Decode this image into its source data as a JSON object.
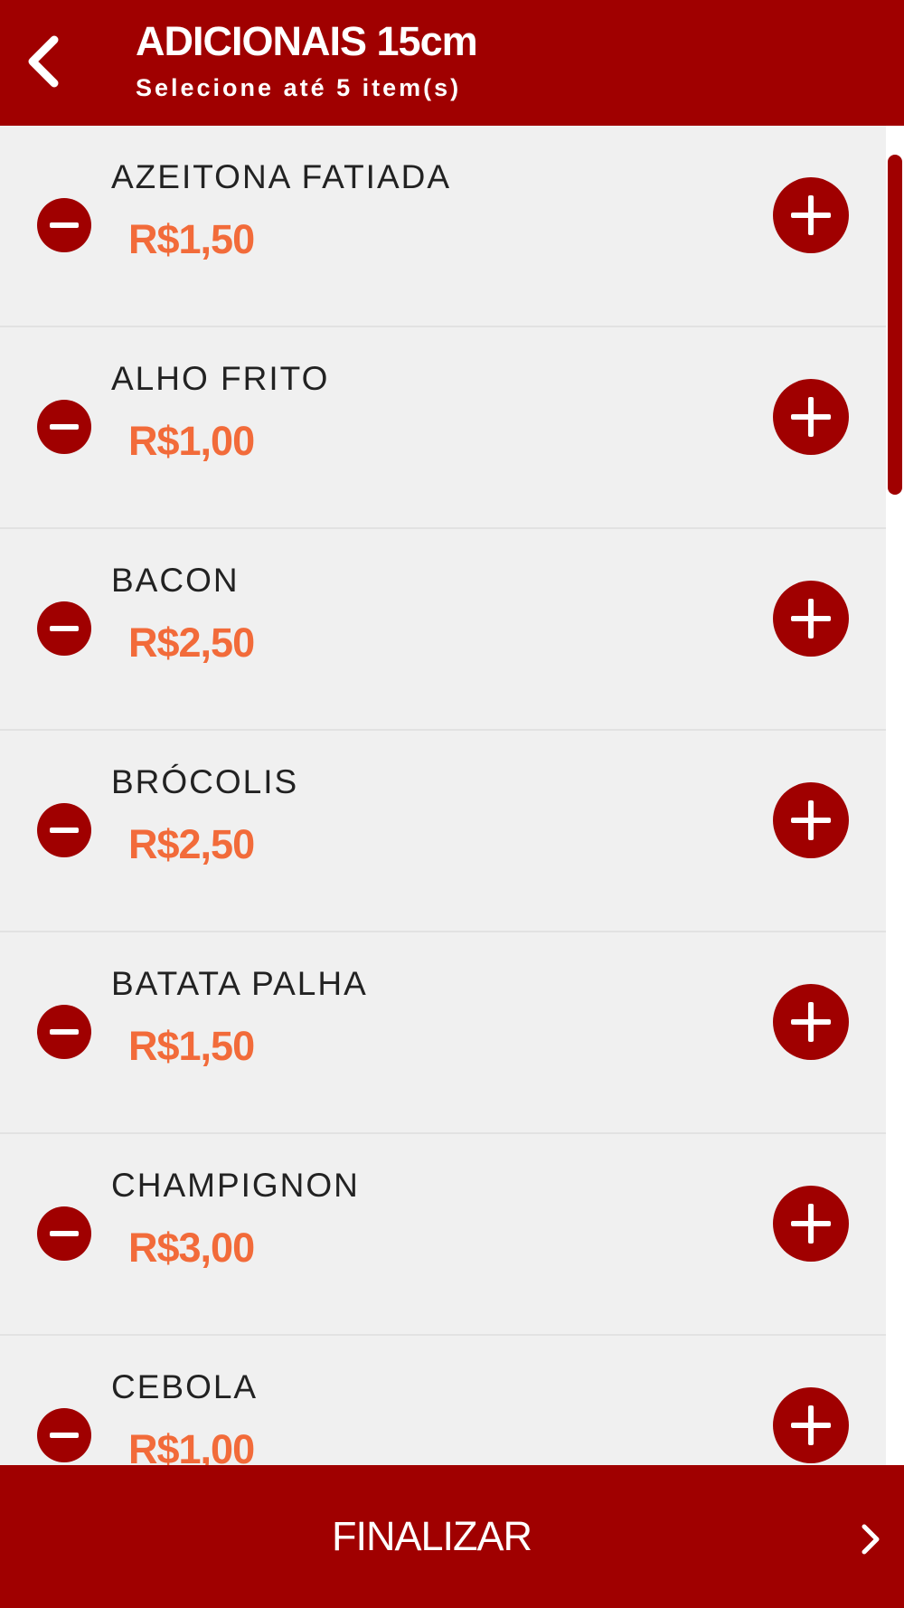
{
  "header": {
    "title": "ADICIONAIS 15cm",
    "subtitle": "Selecione até 5 item(s)",
    "back_icon": "chevron-left-icon"
  },
  "items": [
    {
      "name": "AZEITONA FATIADA",
      "price": "R$1,50"
    },
    {
      "name": "ALHO FRITO",
      "price": "R$1,00"
    },
    {
      "name": "BACON",
      "price": "R$2,50"
    },
    {
      "name": "BRÓCOLIS",
      "price": "R$2,50"
    },
    {
      "name": "BATATA PALHA",
      "price": "R$1,50"
    },
    {
      "name": "CHAMPIGNON",
      "price": "R$3,00"
    },
    {
      "name": "CEBOLA",
      "price": "R$1,00"
    }
  ],
  "footer": {
    "finalize_label": "FINALIZAR",
    "chevron_icon": "chevron-right-icon"
  },
  "colors": {
    "brand": "#a00000",
    "price": "#f26b3a",
    "list_background": "#f0f0f0"
  }
}
